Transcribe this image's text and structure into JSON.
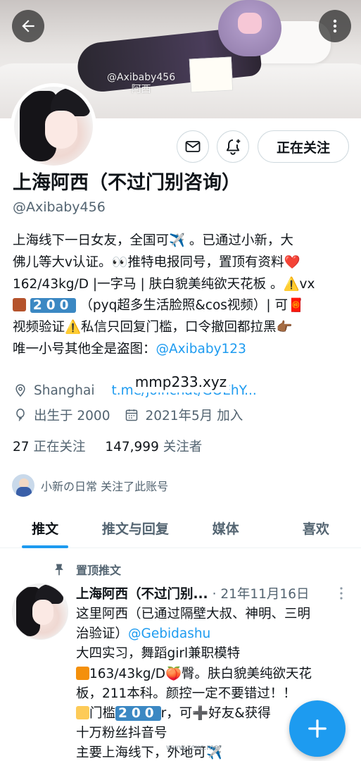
{
  "banner": {
    "watermark_handle": "@Axibaby456",
    "watermark_name": "阿西"
  },
  "profile": {
    "follow_button_label": "正在关注",
    "display_name": "上海阿西（不过门别咨询）",
    "handle": "@Axibaby456",
    "bio": {
      "line1": "上海线下一日女友，全国可✈️ 。已通过小新，大",
      "line2": "佛儿等大v认证。👀推特电报同号，置顶有资料❤️",
      "line3": "162/43kg/D |一字马 | 肤白貌美纯欲天花板 。⚠️vx",
      "line4_digits": "200",
      "line4_text": "（pyq超多生活脸照&cos视频）| 可🧧",
      "line5": "视频验证⚠️私信只回复门槛，口令撤回都拉黑👉🏾",
      "line6_text": "唯一小号其他全是盗图：",
      "line6_link": "@Axibaby123"
    },
    "location": "Shanghai",
    "website": "t.me/joinchat/GOEhY...",
    "overlay_watermark": "mmp233.xyz",
    "born": "出生于 2000",
    "joined": "2021年5月 加入",
    "following_count": "27",
    "following_label": "正在关注",
    "followers_count": "147,999",
    "followers_label": "关注者",
    "followed_by": "小新の日常 关注了此账号"
  },
  "tabs": [
    {
      "label": "推文"
    },
    {
      "label": "推文与回复"
    },
    {
      "label": "媒体"
    },
    {
      "label": "喜欢"
    }
  ],
  "tweet": {
    "pinned_label": "置顶推文",
    "name": "上海阿西（不过门别...",
    "date": "· 21年11月16日",
    "lines": {
      "l1": "这里阿西（已通过隔壁大叔、神明、三明",
      "l2_text": "治验证）",
      "l2_link": "@Gebidashu",
      "l3": "大四实习，舞蹈girl兼职模特",
      "l4": "163/43kg/D🍑臀。肤白貌美纯欲天花",
      "l5": "板，211本科。颜控一定不要错过！！",
      "l6_a": "门槛",
      "l6_digits": "200",
      "l6_b": "r，可➕好友&获得",
      "l7": "十万粉丝抖音号",
      "l8": "主要上海线下，外地可✈️"
    },
    "bottom_watermark": "www.zcvc.me"
  },
  "colors": {
    "accent": "#1d9bf0",
    "text": "#0f1419",
    "muted": "#536471",
    "border": "#cfd9de"
  },
  "icons": [
    "back-arrow-icon",
    "more-vertical-icon",
    "mail-icon",
    "bell-plus-icon",
    "location-pin-icon",
    "link-icon",
    "birthday-balloon-icon",
    "calendar-icon",
    "pin-icon",
    "compose-plus-icon"
  ]
}
